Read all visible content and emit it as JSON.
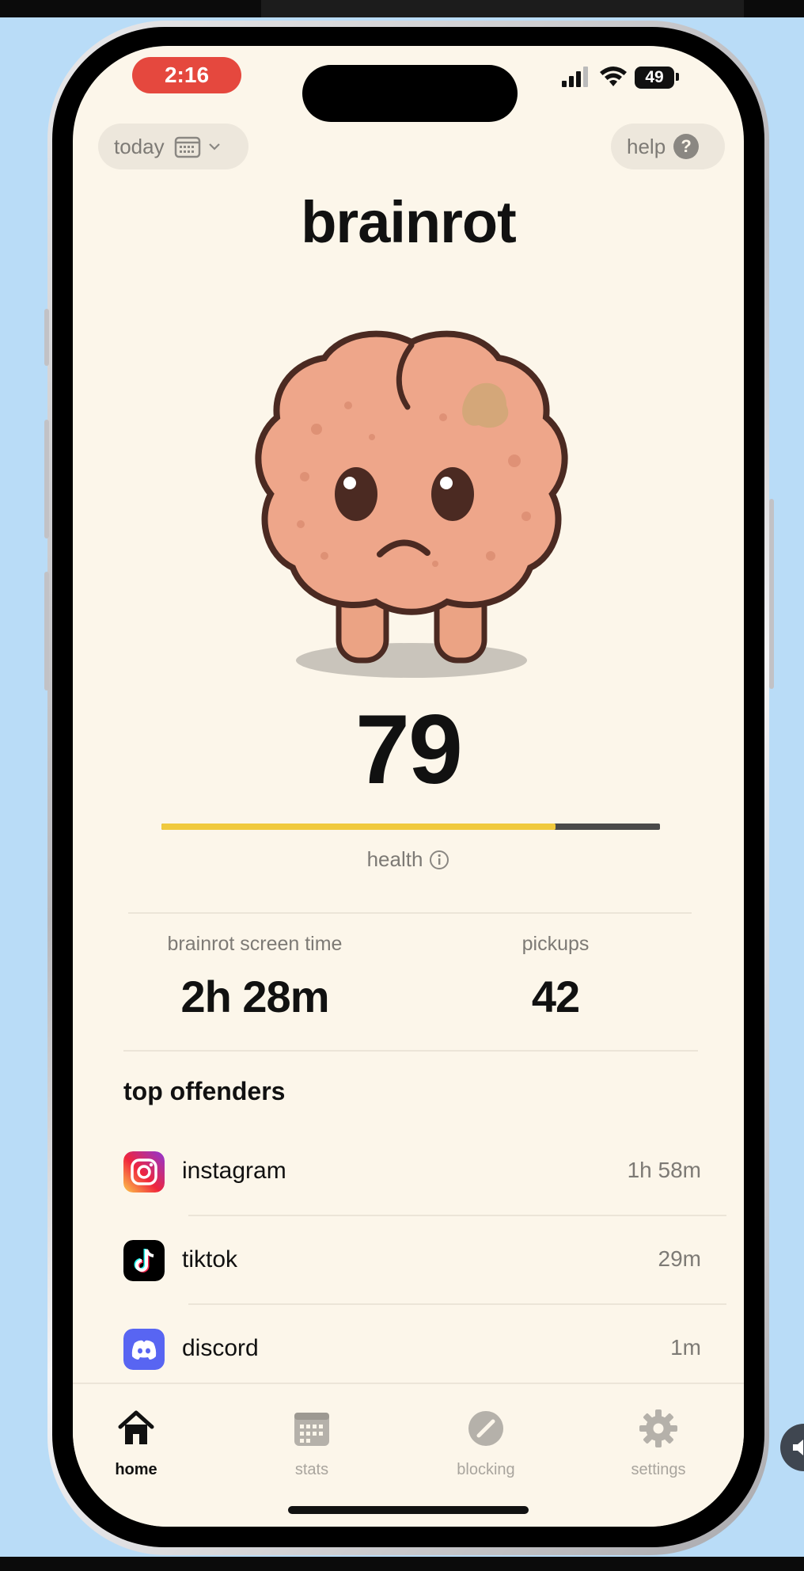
{
  "status_bar": {
    "time": "2:16",
    "battery": "49"
  },
  "header": {
    "date_filter_label": "today",
    "help_label": "help",
    "help_icon_glyph": "?"
  },
  "app_title": "brainrot",
  "mascot": {
    "icon": "sad-brain-mascot"
  },
  "health": {
    "score": "79",
    "progress_fraction": 0.79,
    "label": "health",
    "bar_fill_color": "#f0c93d",
    "bar_track_color": "#4a4a4a"
  },
  "stats": {
    "screen_time_label": "brainrot screen time",
    "screen_time_value": "2h 28m",
    "pickups_label": "pickups",
    "pickups_value": "42"
  },
  "top_offenders": {
    "title": "top offenders",
    "items": [
      {
        "name": "instagram",
        "time": "1h 58m",
        "icon": "instagram-icon"
      },
      {
        "name": "tiktok",
        "time": "29m",
        "icon": "tiktok-icon"
      },
      {
        "name": "discord",
        "time": "1m",
        "icon": "discord-icon"
      }
    ]
  },
  "tabs": [
    {
      "label": "home",
      "icon": "home-icon",
      "active": true
    },
    {
      "label": "stats",
      "icon": "calendar-icon",
      "active": false
    },
    {
      "label": "blocking",
      "icon": "block-icon",
      "active": false
    },
    {
      "label": "settings",
      "icon": "gear-icon",
      "active": false
    }
  ],
  "colors": {
    "background": "#fcf6ea",
    "time_pill": "#e5483e"
  }
}
